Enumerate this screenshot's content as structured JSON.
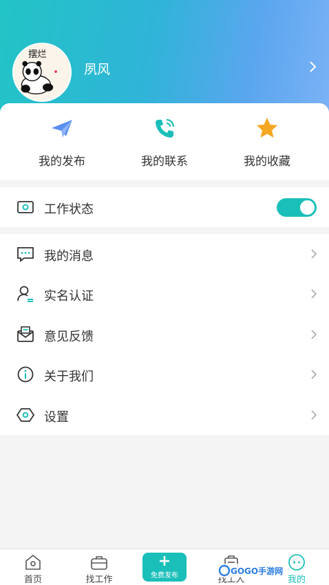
{
  "profile": {
    "name": "夙风",
    "avatar_text": "摆烂"
  },
  "quick_actions": [
    {
      "label": "我的发布",
      "icon": "paper-plane-icon"
    },
    {
      "label": "我的联系",
      "icon": "phone-icon"
    },
    {
      "label": "我的收藏",
      "icon": "star-icon"
    }
  ],
  "status": {
    "label": "工作状态",
    "icon": "status-card-icon",
    "toggle_on": true
  },
  "menu": [
    {
      "label": "我的消息",
      "icon": "message-icon"
    },
    {
      "label": "实名认证",
      "icon": "user-verify-icon"
    },
    {
      "label": "意见反馈",
      "icon": "feedback-mail-icon"
    },
    {
      "label": "关于我们",
      "icon": "info-icon"
    },
    {
      "label": "设置",
      "icon": "settings-hex-icon"
    }
  ],
  "tabbar": {
    "items": [
      {
        "label": "首页",
        "icon": "home-icon"
      },
      {
        "label": "找工作",
        "icon": "briefcase-icon"
      },
      {
        "label": "免费发布",
        "icon": "plus-icon"
      },
      {
        "label": "找工人",
        "icon": "worker-icon"
      },
      {
        "label": "我的",
        "icon": "profile-face-icon"
      }
    ],
    "active_index": 4
  },
  "watermark": {
    "text": "GOGO手游网"
  },
  "colors": {
    "accent": "#1bbfb9",
    "header_start": "#22c4c6",
    "header_end": "#7cb2f6",
    "star": "#f5a623",
    "plane": "#5b8ff0"
  }
}
